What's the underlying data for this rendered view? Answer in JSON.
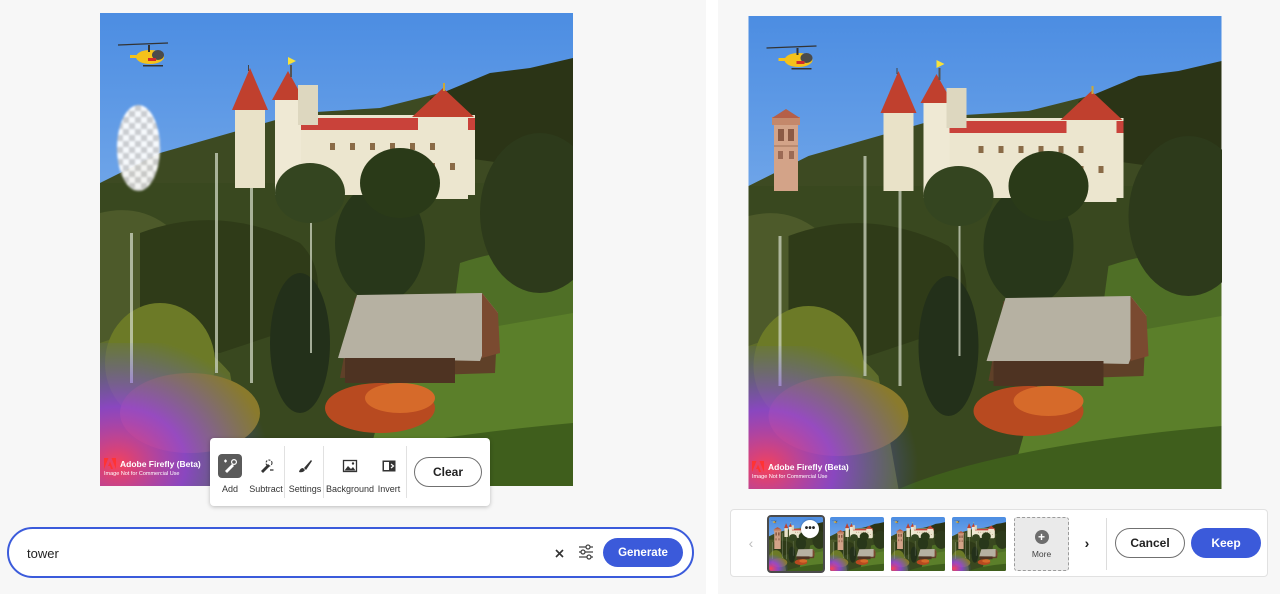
{
  "left_panel": {
    "watermark": {
      "title": "Adobe Firefly (Beta)",
      "subtitle": "Image Not for Commercial Use"
    },
    "toolbar": {
      "tools": [
        {
          "label": "Add",
          "icon": "brush-add-icon",
          "selected": true
        },
        {
          "label": "Subtract",
          "icon": "brush-subtract-icon",
          "selected": false
        },
        {
          "label": "Settings",
          "icon": "brush-settings-icon",
          "selected": false
        },
        {
          "label": "Background",
          "icon": "background-image-icon",
          "selected": false
        },
        {
          "label": "Invert",
          "icon": "invert-icon",
          "selected": false
        }
      ],
      "clear_label": "Clear"
    },
    "prompt": {
      "value": "tower",
      "clear_icon": "close-icon",
      "settings_icon": "sliders-icon",
      "generate_label": "Generate"
    }
  },
  "right_panel": {
    "watermark": {
      "title": "Adobe Firefly (Beta)",
      "subtitle": "Image Not for Commercial Use"
    },
    "variations": {
      "prev_icon": "chevron-left-icon",
      "next_icon": "chevron-right-icon",
      "menu_icon": "more-horizontal-icon",
      "menu_glyph": "•••",
      "selected_index": 0,
      "more_label": "More",
      "more_icon": "plus-circle-icon",
      "cancel_label": "Cancel",
      "keep_label": "Keep",
      "prev_glyph": "‹",
      "next_glyph": "›"
    }
  },
  "colors": {
    "accent": "#3b5ada",
    "panel_background": "#f7f7f7"
  }
}
